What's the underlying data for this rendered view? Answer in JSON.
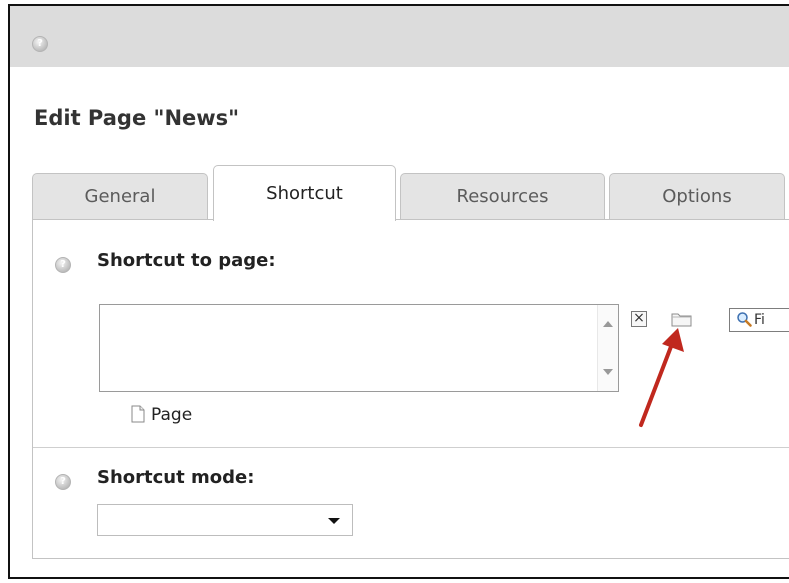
{
  "page": {
    "title": "Edit Page \"News\""
  },
  "tabs": [
    {
      "label": "General",
      "active": false
    },
    {
      "label": "Shortcut",
      "active": true
    },
    {
      "label": "Resources",
      "active": false
    },
    {
      "label": "Options",
      "active": false
    }
  ],
  "shortcut_to_page": {
    "label": "Shortcut to page:",
    "selected_items": [],
    "find_label": "Fi",
    "item_type_label": "Page"
  },
  "shortcut_mode": {
    "label": "Shortcut mode:",
    "selected_value": ""
  },
  "icons": {
    "help": "help-icon",
    "remove": "close-icon",
    "browse": "folder-icon",
    "search": "magnifier-icon",
    "page": "page-icon",
    "annotation": "red-arrow"
  },
  "colors": {
    "annotation_arrow": "#c0281e",
    "topbar": "#dcdcdc",
    "tab_inactive": "#e4e4e4"
  }
}
